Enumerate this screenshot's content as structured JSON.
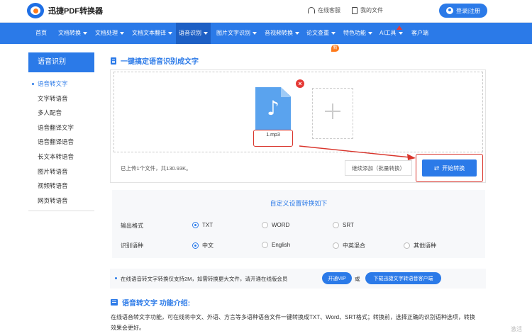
{
  "header": {
    "logo_text": "迅捷PDF转换器",
    "links": [
      {
        "label": "在线客服",
        "icon": "headset-icon"
      },
      {
        "label": "我的文件",
        "icon": "file-icon"
      }
    ],
    "login_label": "登录|注册"
  },
  "nav": {
    "items": [
      {
        "label": "首页",
        "caret": false
      },
      {
        "label": "文档转换",
        "caret": true
      },
      {
        "label": "文档处理",
        "caret": true
      },
      {
        "label": "文档文本翻译",
        "caret": true
      },
      {
        "label": "语音识别",
        "caret": true,
        "active": true
      },
      {
        "label": "图片文字识别",
        "caret": true
      },
      {
        "label": "音视频转换",
        "caret": true
      },
      {
        "label": "论文查重",
        "caret": true,
        "badge": "新"
      },
      {
        "label": "特色功能",
        "caret": true
      },
      {
        "label": "AI工具",
        "caret": true
      },
      {
        "label": "客户端",
        "caret": false
      }
    ]
  },
  "sidebar": {
    "title": "语音识别",
    "items": [
      {
        "label": "语音转文字",
        "active": true
      },
      {
        "label": "文字转语音"
      },
      {
        "label": "多人配音"
      },
      {
        "label": "语音翻译文字"
      },
      {
        "label": "语音翻译语音"
      },
      {
        "label": "长文本转语音"
      },
      {
        "label": "图片转语音"
      },
      {
        "label": "视频转语音"
      },
      {
        "label": "网页转语音"
      }
    ]
  },
  "main": {
    "section_title": "一键搞定语音识别成文字",
    "file": {
      "name": "1.mp3",
      "icon": "music-note-icon"
    },
    "uploaded_info": "已上传1个文件，共130.93K。",
    "continue_label": "继续添加（批量转换）",
    "start_label": "开始转换",
    "settings": {
      "title": "自定义设置转换如下",
      "output_label": "输出格式",
      "output_options": [
        "TXT",
        "WORD",
        "SRT"
      ],
      "output_selected": "TXT",
      "language_label": "识别语种",
      "language_options": [
        "中文",
        "English",
        "中英混合",
        "其他语种"
      ],
      "language_selected": "中文"
    },
    "notice": {
      "text": "在线语音转文字转换仅支持2M，如需转换更大文件，请开通在线版会员",
      "vip_label": "开通VIP",
      "or_label": "或",
      "download_label": "下载迅捷文字转语音客户端"
    },
    "intro": {
      "title": "语音转文字 功能介绍:",
      "body": "在线语音转文字功能，可在线将中文、外语、方言等多语种语音文件一键转换成TXT、Word、SRT格式；转换前，选择正确的识别语种选项，转换效果会更好。"
    }
  },
  "watermark": "激活",
  "colors": {
    "accent": "#2b7ae8",
    "highlight_red": "#d9342b",
    "badge_orange": "#ff7a1a"
  }
}
